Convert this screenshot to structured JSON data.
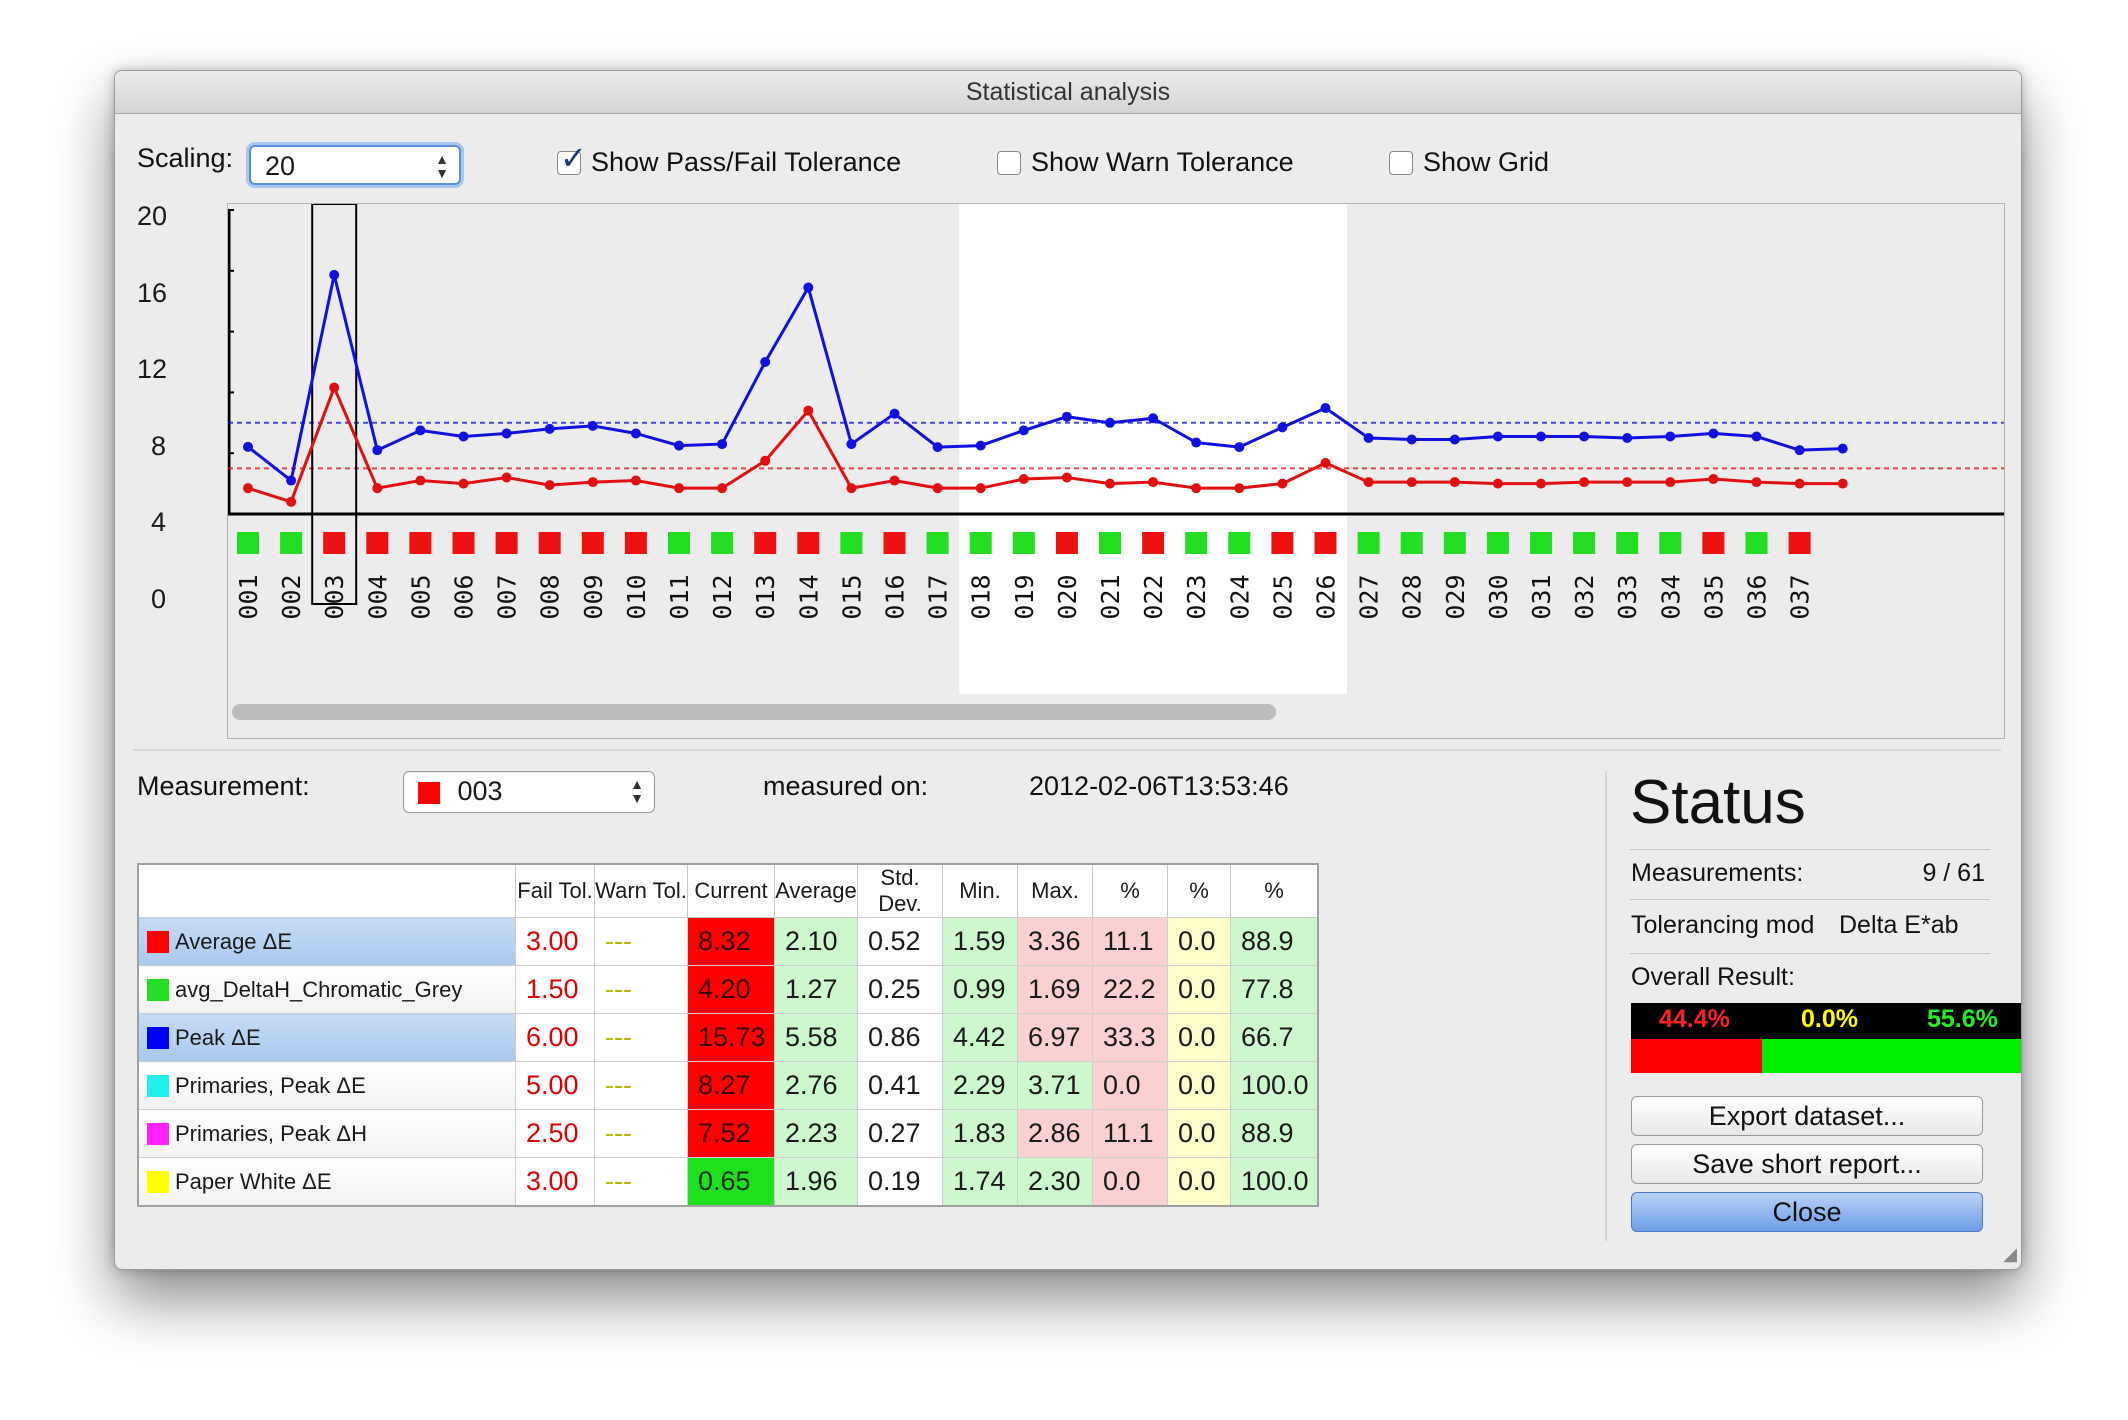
{
  "window": {
    "title": "Statistical analysis"
  },
  "toolbar": {
    "scaling_label": "Scaling:",
    "scaling_value": "20",
    "show_passfail_label": "Show Pass/Fail Tolerance",
    "show_passfail_checked": true,
    "show_warn_label": "Show Warn Tolerance",
    "show_warn_checked": false,
    "show_grid_label": "Show Grid",
    "show_grid_checked": false
  },
  "chart_data": {
    "type": "line",
    "ylim": [
      0,
      20
    ],
    "yticks": [
      "20",
      "16",
      "12",
      "8",
      "4",
      "0"
    ],
    "grid": false,
    "categories": [
      "001",
      "002",
      "003",
      "004",
      "005",
      "006",
      "007",
      "008",
      "009",
      "010",
      "011",
      "012",
      "013",
      "014",
      "015",
      "016",
      "017",
      "018",
      "019",
      "020",
      "021",
      "022",
      "023",
      "024",
      "025",
      "026",
      "027",
      "028",
      "029",
      "030",
      "031",
      "032",
      "033",
      "034",
      "035",
      "036",
      "037"
    ],
    "series": [
      {
        "name": "Peak ΔE",
        "color": "#1010e0",
        "tolerance": 6.0,
        "values": [
          4.42,
          2.2,
          15.73,
          4.2,
          5.5,
          5.1,
          5.3,
          5.6,
          5.8,
          5.3,
          4.5,
          4.6,
          10.0,
          14.9,
          4.6,
          6.6,
          4.4,
          4.5,
          5.5,
          6.4,
          6.0,
          6.3,
          4.7,
          4.4,
          5.7,
          6.97,
          5.0,
          4.9,
          4.9,
          5.1,
          5.1,
          5.1,
          5.0,
          5.1,
          5.3,
          5.1,
          4.2,
          4.3
        ]
      },
      {
        "name": "Average ΔE",
        "color": "#e01010",
        "tolerance": 3.0,
        "values": [
          1.7,
          0.8,
          8.32,
          1.7,
          2.2,
          2.0,
          2.4,
          1.9,
          2.1,
          2.2,
          1.7,
          1.7,
          3.5,
          6.8,
          1.7,
          2.2,
          1.7,
          1.7,
          2.3,
          2.4,
          2.0,
          2.1,
          1.7,
          1.7,
          2.0,
          3.36,
          2.1,
          2.1,
          2.1,
          2.0,
          2.0,
          2.1,
          2.1,
          2.1,
          2.3,
          2.1,
          2.0,
          2.0
        ]
      }
    ],
    "status": [
      "pass",
      "pass",
      "fail",
      "fail",
      "fail",
      "fail",
      "fail",
      "fail",
      "fail",
      "fail",
      "pass",
      "pass",
      "fail",
      "fail",
      "pass",
      "fail",
      "pass",
      "pass",
      "pass",
      "fail",
      "pass",
      "fail",
      "pass",
      "pass",
      "fail",
      "fail",
      "pass",
      "pass",
      "pass",
      "pass",
      "pass",
      "pass",
      "pass",
      "pass",
      "fail",
      "pass",
      "fail"
    ],
    "selected_index": 2,
    "highlight_range": [
      "018",
      "026"
    ],
    "colors": {
      "pass": "#22dd22",
      "fail": "#ee1111"
    }
  },
  "measurement": {
    "label": "Measurement:",
    "value": "003",
    "value_color": "#ff0000",
    "measured_on_label": "measured on:",
    "measured_on_value": "2012-02-06T13:53:46"
  },
  "table": {
    "headers": [
      "",
      "Fail Tol.",
      "Warn Tol.",
      "Current",
      "Average",
      "Std. Dev.",
      "Min.",
      "Max.",
      "%",
      "%",
      "%"
    ],
    "rows": [
      {
        "name": "Average ΔE",
        "swatch": "#ff0000",
        "selected": true,
        "cells": [
          "3.00",
          "---",
          "8.32",
          "2.10",
          "0.52",
          "1.59",
          "3.36",
          "11.1",
          "0.0",
          "88.9"
        ],
        "current_status": "fail",
        "avg_status": "pass",
        "min_status": "pass",
        "max_status": "fail"
      },
      {
        "name": "avg_DeltaH_Chromatic_Grey",
        "swatch": "#22dd22",
        "selected": false,
        "cells": [
          "1.50",
          "---",
          "4.20",
          "1.27",
          "0.25",
          "0.99",
          "1.69",
          "22.2",
          "0.0",
          "77.8"
        ],
        "current_status": "fail",
        "avg_status": "pass",
        "min_status": "pass",
        "max_status": "fail"
      },
      {
        "name": "Peak ΔE",
        "swatch": "#0000ff",
        "selected": true,
        "cells": [
          "6.00",
          "---",
          "15.73",
          "5.58",
          "0.86",
          "4.42",
          "6.97",
          "33.3",
          "0.0",
          "66.7"
        ],
        "current_status": "fail",
        "avg_status": "pass",
        "min_status": "pass",
        "max_status": "fail"
      },
      {
        "name": "Primaries, Peak ΔE",
        "swatch": "#22eeee",
        "selected": false,
        "cells": [
          "5.00",
          "---",
          "8.27",
          "2.76",
          "0.41",
          "2.29",
          "3.71",
          "0.0",
          "0.0",
          "100.0"
        ],
        "current_status": "fail",
        "avg_status": "pass",
        "min_status": "pass",
        "max_status": "pass"
      },
      {
        "name": "Primaries, Peak ΔH",
        "swatch": "#ff22ff",
        "selected": false,
        "cells": [
          "2.50",
          "---",
          "7.52",
          "2.23",
          "0.27",
          "1.83",
          "2.86",
          "11.1",
          "0.0",
          "88.9"
        ],
        "current_status": "fail",
        "avg_status": "pass",
        "min_status": "pass",
        "max_status": "fail"
      },
      {
        "name": "Paper White ΔE",
        "swatch": "#ffff00",
        "selected": false,
        "cells": [
          "3.00",
          "---",
          "0.65",
          "1.96",
          "0.19",
          "1.74",
          "2.30",
          "0.0",
          "0.0",
          "100.0"
        ],
        "current_status": "pass",
        "avg_status": "pass",
        "min_status": "pass",
        "max_status": "pass"
      }
    ]
  },
  "status": {
    "title": "Status",
    "measurements_label": "Measurements:",
    "measurements_value": "9 / 61",
    "tolerancing_label": "Tolerancing mod",
    "tolerancing_value": "Delta E*ab",
    "overall_label": "Overall Result:",
    "fail_pct": "44.4%",
    "warn_pct": "0.0%",
    "pass_pct": "55.6%",
    "fail_fraction": 0.444,
    "pass_fraction": 0.556
  },
  "buttons": {
    "export": "Export dataset...",
    "save_report": "Save short report...",
    "close": "Close"
  }
}
